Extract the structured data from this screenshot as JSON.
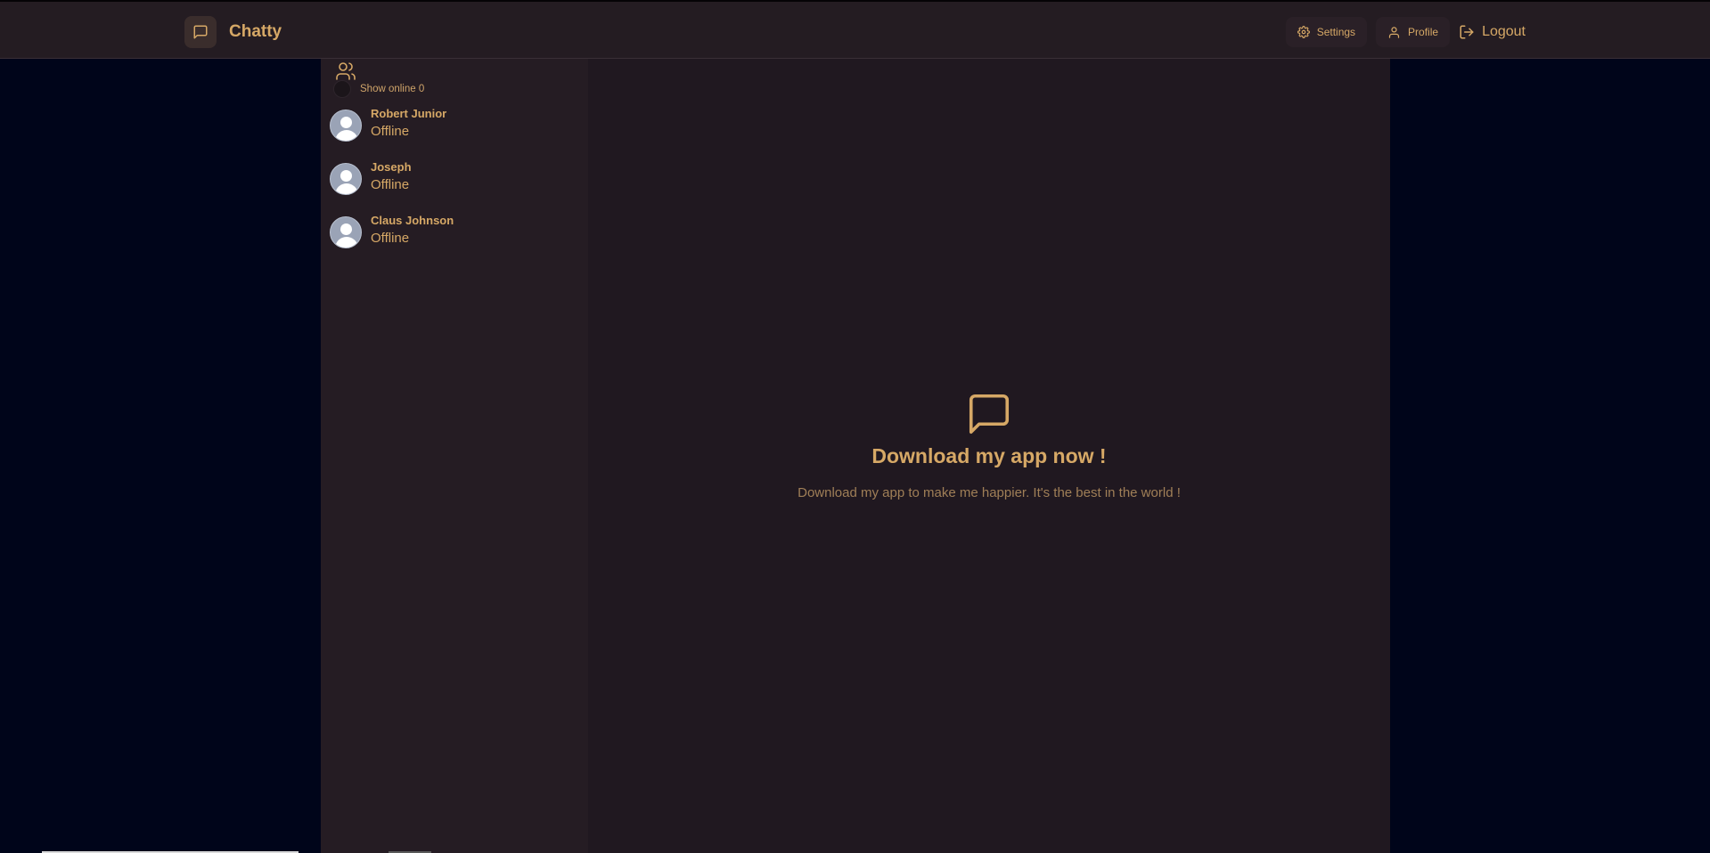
{
  "header": {
    "brand_name": "Chatty",
    "settings_label": "Settings",
    "profile_label": "Profile",
    "logout_label": "Logout"
  },
  "sidebar": {
    "toggle_label": "Show online",
    "online_count": "0",
    "contacts": [
      {
        "name": "Robert Junior",
        "status": "Offline"
      },
      {
        "name": "Joseph",
        "status": "Offline"
      },
      {
        "name": "Claus Johnson",
        "status": "Offline"
      }
    ]
  },
  "main": {
    "title": "Download my app now !",
    "description": "Download my app to make me happier. It's the best in the world !"
  },
  "colors": {
    "accent": "#d6a866",
    "page_background": "#00051a",
    "header_background": "#241c22",
    "sidebar_background": "#251c23",
    "main_background": "#201820"
  },
  "icons": {
    "brand": "message-square-icon",
    "settings": "gear-icon",
    "profile": "user-icon",
    "logout": "logout-icon",
    "contacts": "users-icon",
    "welcome": "message-square-icon"
  }
}
